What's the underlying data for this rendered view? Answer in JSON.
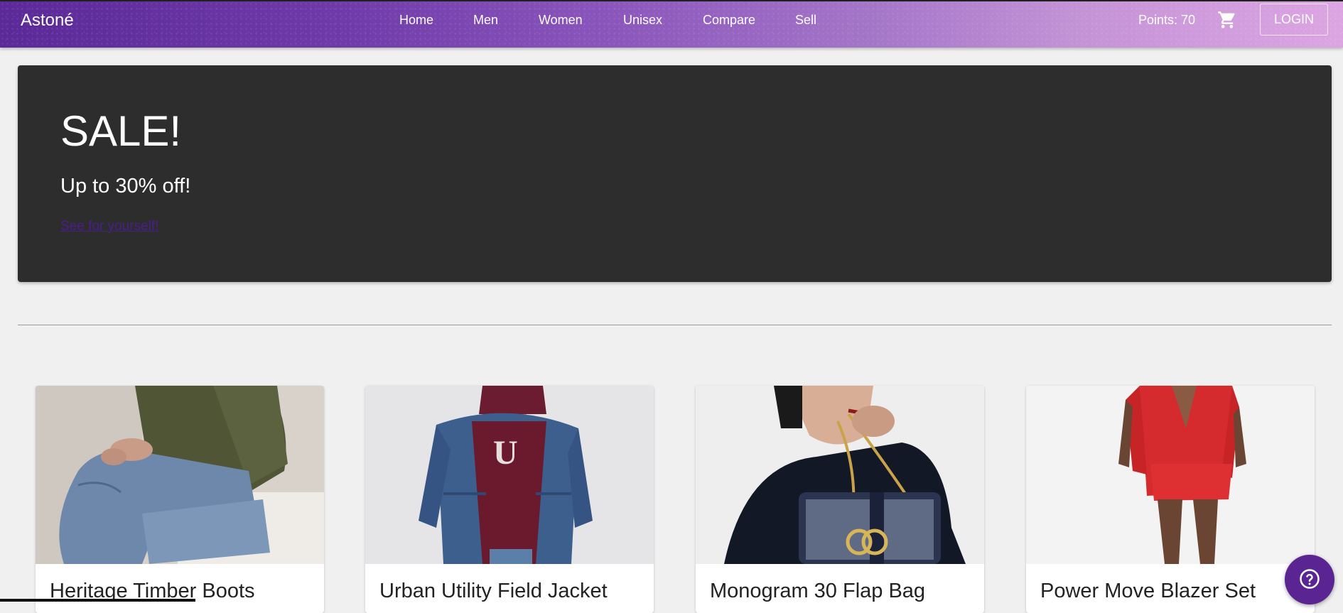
{
  "navbar": {
    "brand": "Astoné",
    "links": [
      "Home",
      "Men",
      "Women",
      "Unisex",
      "Compare",
      "Sell"
    ],
    "points": "Points: 70",
    "cart_icon": "shopping-cart-icon",
    "login": "LOGIN"
  },
  "hero": {
    "title": "SALE!",
    "subtitle": "Up to 30% off!",
    "link": "See for yourself!"
  },
  "products": [
    {
      "title": "Heritage Timber Boots"
    },
    {
      "title": "Urban Utility Field Jacket"
    },
    {
      "title": "Monogram 30 Flap Bag"
    },
    {
      "title": "Power Move Blazer Set"
    }
  ],
  "help": {
    "icon": "help-question-icon"
  },
  "colors": {
    "accent": "#5a2592",
    "hero_bg": "#2d2d2d",
    "page_bg": "#f0f0f0"
  }
}
